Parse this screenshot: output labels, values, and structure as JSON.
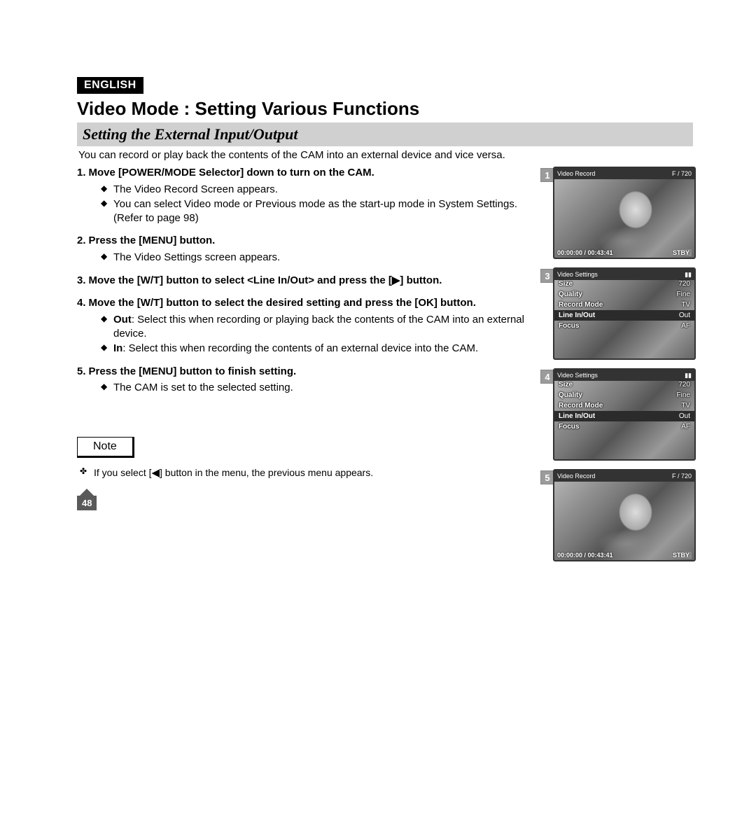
{
  "lang_badge": "ENGLISH",
  "h1": "Video Mode : Setting Various Functions",
  "section_title": "Setting the External Input/Output",
  "intro": "You can record or play back the contents of the CAM into an external device and vice versa.",
  "steps": [
    {
      "num": "1.",
      "title": "Move [POWER/MODE Selector] down to turn on the CAM.",
      "bullets": [
        {
          "text": "The Video Record Screen appears."
        },
        {
          "text": "You can select Video mode or Previous mode as the start-up mode in System Settings. (Refer to page 98)"
        }
      ]
    },
    {
      "num": "2.",
      "title": "Press the [MENU] button.",
      "bullets": [
        {
          "text": "The Video Settings screen appears."
        }
      ]
    },
    {
      "num": "3.",
      "title_pre": "Move the [W/T] button to select <Line In/Out> and press the [",
      "title_post": "] button.",
      "arrow": "▶",
      "bullets": []
    },
    {
      "num": "4.",
      "title": "Move the [W/T] button to select the desired setting and press the [OK] button.",
      "bullets": [
        {
          "label": "Out",
          "text": ": Select this when recording or playing back the contents of the CAM into an external device."
        },
        {
          "label": "In",
          "text": ": Select this when recording the contents of an external device into the CAM."
        }
      ]
    },
    {
      "num": "5.",
      "title": "Press the [MENU] button to finish setting.",
      "bullets": [
        {
          "text": "The CAM is set to the selected setting."
        }
      ]
    }
  ],
  "note_label": "Note",
  "notes": [
    {
      "pre": "If you select [",
      "arrow": "◀",
      "post": "] button in the menu, the previous menu appears."
    }
  ],
  "page_number": "48",
  "screens": [
    {
      "num": "1",
      "title": "Video Record",
      "badge": "F / 720",
      "status_left": "00:00:00 / 00:43:41",
      "status_right": "STBY",
      "type": "record"
    },
    {
      "num": "3",
      "title": "Video Settings",
      "type": "menu",
      "rows": [
        {
          "k": "Size",
          "v": "720"
        },
        {
          "k": "Quality",
          "v": "Fine"
        },
        {
          "k": "Record Mode",
          "v": "TV"
        },
        {
          "k": "Line In/Out",
          "v": "Out",
          "hl": true
        },
        {
          "k": "Focus",
          "v": "AF"
        }
      ]
    },
    {
      "num": "4",
      "title": "Video Settings",
      "type": "menu",
      "rows": [
        {
          "k": "Size",
          "v": "720"
        },
        {
          "k": "Quality",
          "v": "Fine"
        },
        {
          "k": "Record Mode",
          "v": "TV"
        },
        {
          "k": "Line In/Out",
          "v": "Out",
          "hl": true
        },
        {
          "k": "Focus",
          "v": "AF"
        }
      ]
    },
    {
      "num": "5",
      "title": "Video Record",
      "badge": "F / 720",
      "status_left": "00:00:00 / 00:43:41",
      "status_right": "STBY",
      "type": "record"
    }
  ]
}
